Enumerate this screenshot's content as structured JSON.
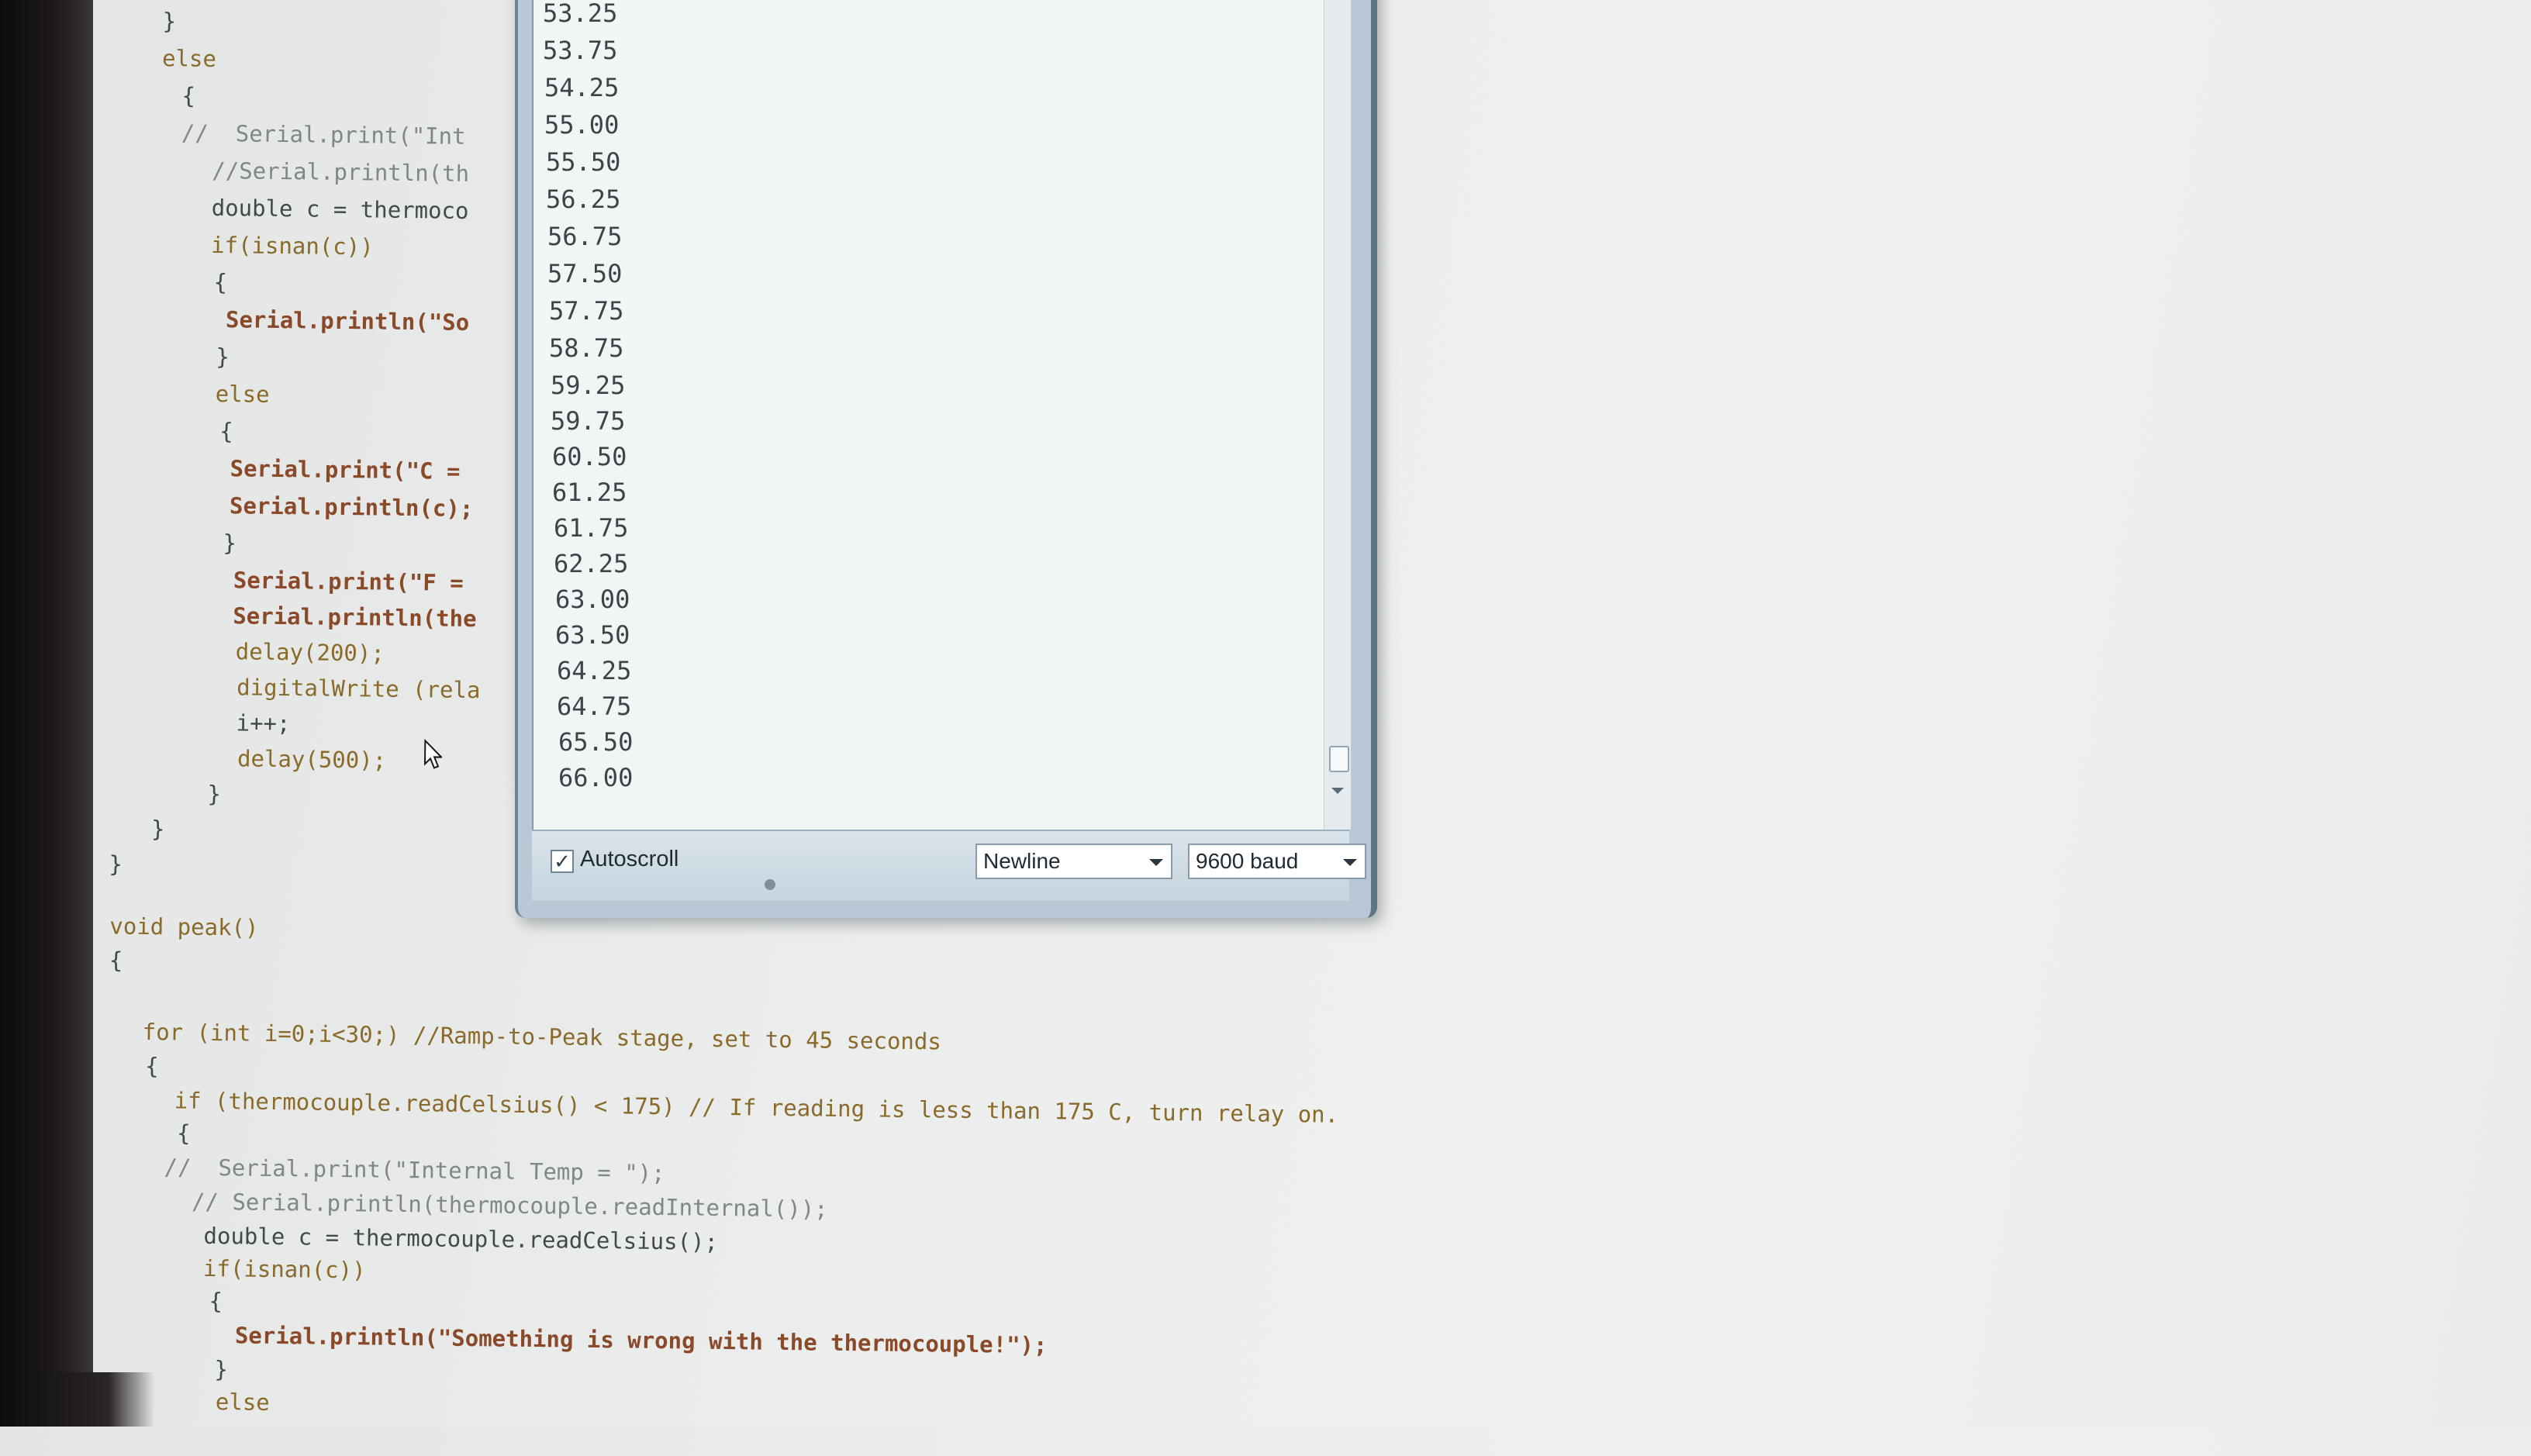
{
  "code_editor": {
    "top_lines": [
      "}",
      "else",
      "{",
      "//  Serial.print(\"Int",
      "//Serial.println(th",
      "double c = thermoco",
      "if(isnan(c))",
      "{",
      "Serial.println(\"So",
      "}",
      "else",
      "{",
      "Serial.print(\"C = ",
      "Serial.println(c);",
      "}",
      "Serial.print(\"F = ",
      "Serial.println(the",
      "delay(200);",
      "digitalWrite (rela",
      "i++;",
      "delay(500);",
      "}",
      "}",
      "}"
    ],
    "bottom_lines": [
      "void peak()",
      "{",
      "for (int i=0;i<30;) //Ramp-to-Peak stage, set to 45 seconds",
      "{",
      "if (thermocouple.readCelsius() < 175) // If reading is less than 175 C, turn relay on.",
      "{",
      "//  Serial.print(\"Internal Temp = \");",
      "// Serial.println(thermocouple.readInternal());",
      "double c = thermocouple.readCelsius();",
      "if(isnan(c))",
      "{",
      "Serial.println(\"Something is wrong with the thermocouple!\");",
      "}",
      "else"
    ]
  },
  "serial_monitor": {
    "output_lines": [
      "53.25",
      "53.75",
      "54.25",
      "55.00",
      "55.50",
      "56.25",
      "56.75",
      "57.50",
      "57.75",
      "58.75",
      "59.25",
      "59.75",
      "60.50",
      "61.25",
      "61.75",
      "62.25",
      "63.00",
      "63.50",
      "64.25",
      "64.75",
      "65.50",
      "66.00"
    ],
    "autoscroll_label": "Autoscroll",
    "autoscroll_checked": true,
    "line_ending": "Newline",
    "baud_rate": "9600 baud"
  }
}
